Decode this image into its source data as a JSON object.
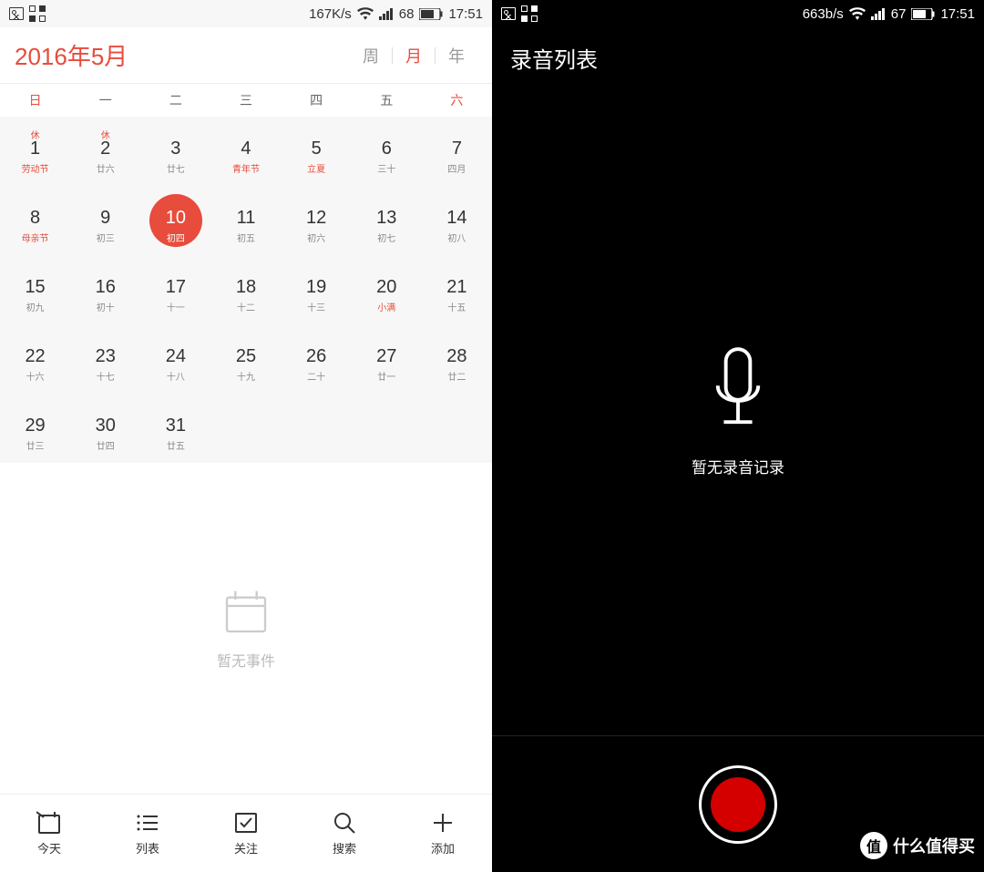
{
  "left": {
    "status": {
      "speed": "167K/s",
      "battery": "68",
      "time": "17:51"
    },
    "title": "2016年5月",
    "views": {
      "week": "周",
      "month": "月",
      "year": "年",
      "active": "月"
    },
    "weekdays": [
      "日",
      "一",
      "二",
      "三",
      "四",
      "五",
      "六"
    ],
    "days": [
      {
        "num": "1",
        "top": "休",
        "sub": "劳动节",
        "subRed": true
      },
      {
        "num": "2",
        "top": "休",
        "sub": "廿六"
      },
      {
        "num": "3",
        "sub": "廿七"
      },
      {
        "num": "4",
        "sub": "青年节",
        "subRed": true
      },
      {
        "num": "5",
        "sub": "立夏",
        "subRed": true
      },
      {
        "num": "6",
        "sub": "三十"
      },
      {
        "num": "7",
        "sub": "四月"
      },
      {
        "num": "8",
        "sub": "母亲节",
        "subRed": true
      },
      {
        "num": "9",
        "sub": "初三"
      },
      {
        "num": "10",
        "sub": "初四",
        "today": true
      },
      {
        "num": "11",
        "sub": "初五"
      },
      {
        "num": "12",
        "sub": "初六"
      },
      {
        "num": "13",
        "sub": "初七"
      },
      {
        "num": "14",
        "sub": "初八"
      },
      {
        "num": "15",
        "sub": "初九"
      },
      {
        "num": "16",
        "sub": "初十"
      },
      {
        "num": "17",
        "sub": "十一"
      },
      {
        "num": "18",
        "sub": "十二"
      },
      {
        "num": "19",
        "sub": "十三"
      },
      {
        "num": "20",
        "sub": "小满",
        "subRed": true
      },
      {
        "num": "21",
        "sub": "十五"
      },
      {
        "num": "22",
        "sub": "十六"
      },
      {
        "num": "23",
        "sub": "十七"
      },
      {
        "num": "24",
        "sub": "十八"
      },
      {
        "num": "25",
        "sub": "十九"
      },
      {
        "num": "26",
        "sub": "二十"
      },
      {
        "num": "27",
        "sub": "廿一"
      },
      {
        "num": "28",
        "sub": "廿二"
      },
      {
        "num": "29",
        "sub": "廿三"
      },
      {
        "num": "30",
        "sub": "廿四"
      },
      {
        "num": "31",
        "sub": "廿五"
      }
    ],
    "emptyText": "暂无事件",
    "nav": {
      "today": "今天",
      "list": "列表",
      "follow": "关注",
      "search": "搜索",
      "add": "添加"
    }
  },
  "right": {
    "status": {
      "speed": "663b/s",
      "battery": "67",
      "time": "17:51"
    },
    "title": "录音列表",
    "emptyText": "暂无录音记录",
    "watermark": {
      "badge": "值",
      "text": "什么值得买"
    }
  }
}
